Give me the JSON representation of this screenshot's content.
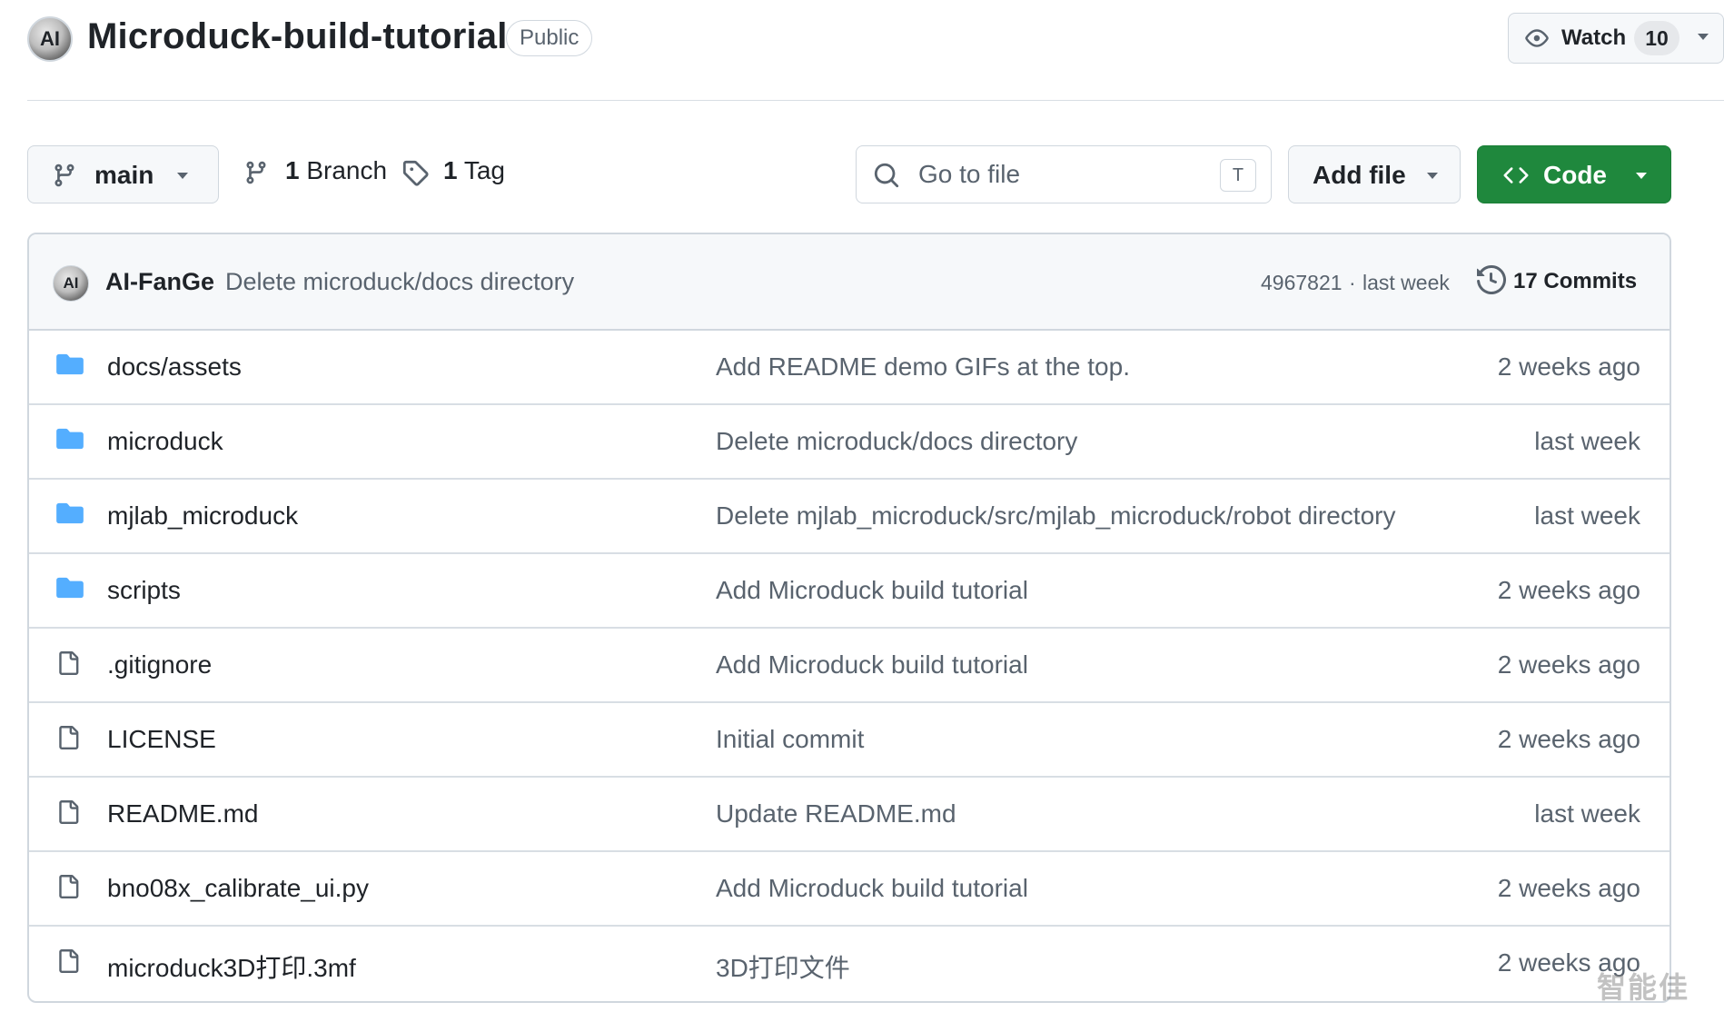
{
  "repo": {
    "owner_avatar_text": "AI",
    "name": "Microduck-build-tutorial",
    "visibility": "Public",
    "watch_label": "Watch",
    "watch_count": "10"
  },
  "toolbar": {
    "branch_name": "main",
    "branches_count": "1",
    "branches_label": "Branch",
    "tags_count": "1",
    "tags_label": "Tag",
    "search_placeholder": "Go to file",
    "search_shortcut": "T",
    "add_file_label": "Add file",
    "code_label": "Code"
  },
  "latest_commit": {
    "avatar_text": "AI",
    "author": "AI-FanGe",
    "message": "Delete microduck/docs directory",
    "hash": "4967821",
    "separator": "·",
    "time": "last week",
    "commits_count": "17",
    "commits_label": "Commits"
  },
  "files": [
    {
      "type": "folder",
      "icon": "folder-icon",
      "name": "docs/assets",
      "message": "Add README demo GIFs at the top.",
      "time": "2 weeks ago"
    },
    {
      "type": "folder",
      "icon": "folder-icon",
      "name": "microduck",
      "message": "Delete microduck/docs directory",
      "time": "last week"
    },
    {
      "type": "folder",
      "icon": "folder-icon",
      "name": "mjlab_microduck",
      "message": "Delete mjlab_microduck/src/mjlab_microduck/robot directory",
      "time": "last week"
    },
    {
      "type": "folder",
      "icon": "folder-icon",
      "name": "scripts",
      "message": "Add Microduck build tutorial",
      "time": "2 weeks ago"
    },
    {
      "type": "file",
      "icon": "file-icon",
      "name": ".gitignore",
      "message": "Add Microduck build tutorial",
      "time": "2 weeks ago"
    },
    {
      "type": "file",
      "icon": "file-icon",
      "name": "LICENSE",
      "message": "Initial commit",
      "time": "2 weeks ago"
    },
    {
      "type": "file",
      "icon": "file-icon",
      "name": "README.md",
      "message": "Update README.md",
      "time": "last week"
    },
    {
      "type": "file",
      "icon": "file-icon",
      "name": "bno08x_calibrate_ui.py",
      "message": "Add Microduck build tutorial",
      "time": "2 weeks ago"
    },
    {
      "type": "file",
      "icon": "file-icon",
      "name": "microduck3D打印.3mf",
      "message": "3D打印文件",
      "time": "2 weeks ago"
    }
  ],
  "watermark": "智能佳",
  "colors": {
    "code_button": "#1f883d",
    "folder": "#54aeff",
    "muted_text": "#59636e",
    "border": "#d0d7de"
  }
}
